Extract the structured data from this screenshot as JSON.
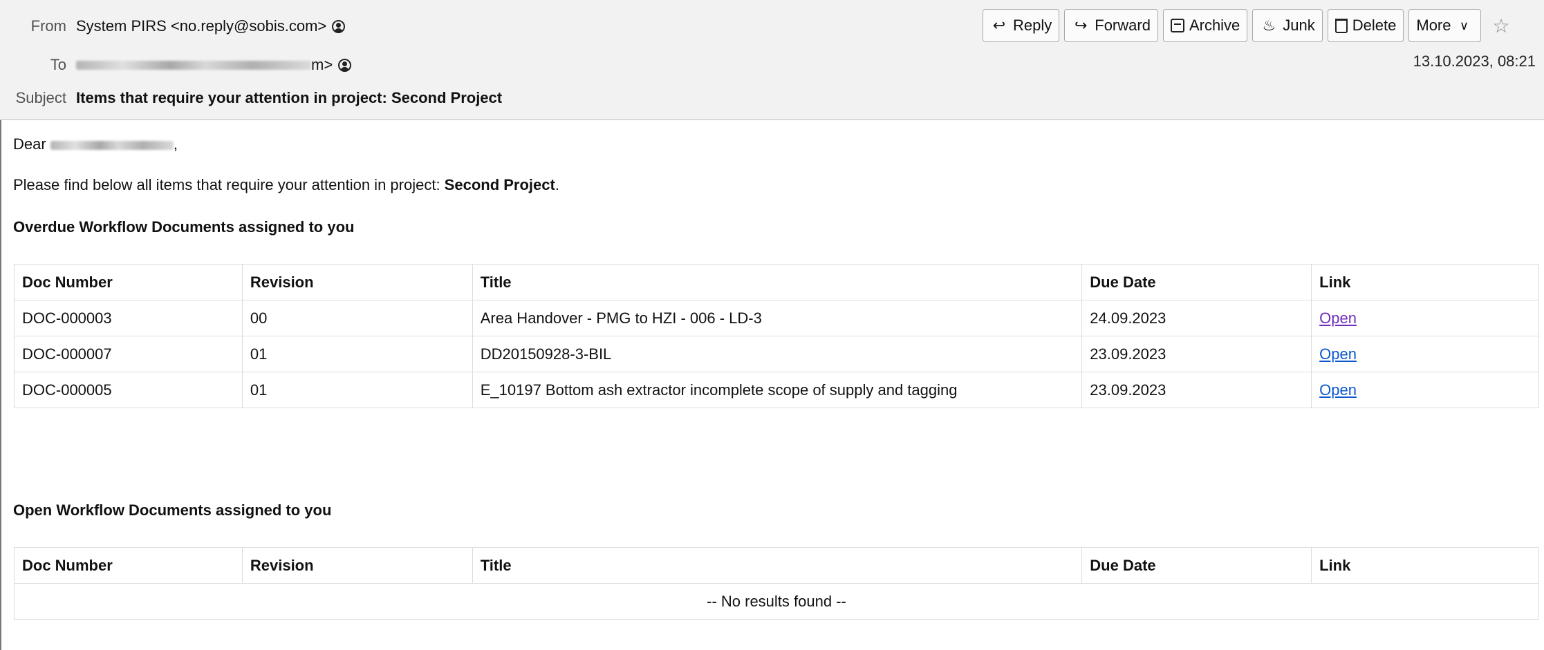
{
  "header": {
    "from_label": "From",
    "from_value": "System PIRS <no.reply@sobis.com>",
    "to_label": "To",
    "to_suffix": "m>",
    "subject_label": "Subject",
    "subject_value": "Items that require your attention in project: Second Project",
    "date": "13.10.2023, 08:21"
  },
  "toolbar": {
    "reply": "Reply",
    "forward": "Forward",
    "archive": "Archive",
    "junk": "Junk",
    "delete": "Delete",
    "more": "More"
  },
  "body": {
    "greeting_prefix": "Dear",
    "greeting_suffix": ",",
    "intro_text": "Please find below all items that require your attention in project: ",
    "intro_project": "Second Project",
    "intro_end": ".",
    "overdue_title": "Overdue Workflow Documents assigned to you",
    "open_title": "Open Workflow Documents assigned to you"
  },
  "columns": [
    "Doc Number",
    "Revision",
    "Title",
    "Due Date",
    "Link"
  ],
  "overdue_rows": [
    {
      "doc": "DOC-000003",
      "rev": "00",
      "title": "Area Handover - PMG to HZI - 006 - LD-3",
      "due": "24.09.2023",
      "link": "Open"
    },
    {
      "doc": "DOC-000007",
      "rev": "01",
      "title": "DD20150928-3-BIL",
      "due": "23.09.2023",
      "link": "Open"
    },
    {
      "doc": "DOC-000005",
      "rev": "01",
      "title": "E_10197 Bottom ash extractor incomplete scope of supply and tagging",
      "due": "23.09.2023",
      "link": "Open"
    }
  ],
  "open_empty": "-- No results found --",
  "colors": {
    "link": "#0b57d0",
    "visited_link": "#6f2dbd",
    "header_bg": "#f2f2f2"
  }
}
